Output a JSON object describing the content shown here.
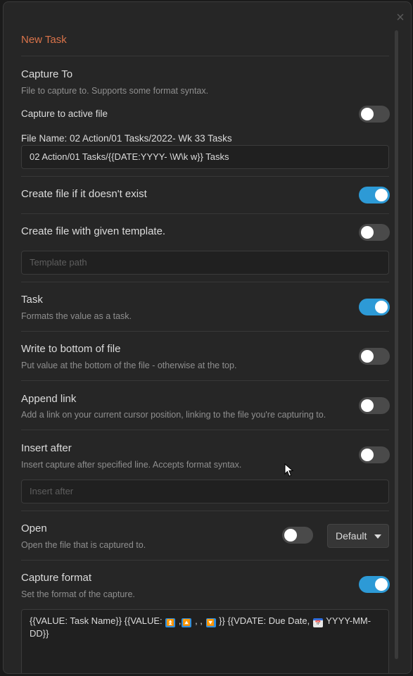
{
  "title": "New Task",
  "close_glyph": "×",
  "capture_to": {
    "name": "Capture To",
    "desc": "File to capture to. Supports some format syntax.",
    "active_file_label": "Capture to active file",
    "active_file_on": false,
    "file_name_label": "File Name: 02 Action/01 Tasks/2022- Wk 33 Tasks",
    "file_name_value": "02 Action/01 Tasks/{{DATE:YYYY-  \\W\\k w}} Tasks"
  },
  "create_file": {
    "name": "Create file if it doesn't exist",
    "on": true
  },
  "template": {
    "name": "Create file with given template.",
    "on": false,
    "placeholder": "Template path"
  },
  "task": {
    "name": "Task",
    "desc": "Formats the value as a task.",
    "on": true
  },
  "write_bottom": {
    "name": "Write to bottom of file",
    "desc": "Put value at the bottom of the file - otherwise at the top.",
    "on": false
  },
  "append_link": {
    "name": "Append link",
    "desc": "Add a link on your current cursor position, linking to the file you're capturing to.",
    "on": false
  },
  "insert_after": {
    "name": "Insert after",
    "desc": "Insert capture after specified line. Accepts format syntax.",
    "on": false,
    "placeholder": "Insert after"
  },
  "open": {
    "name": "Open",
    "desc": "Open the file that is captured to.",
    "on": false,
    "select_value": "Default"
  },
  "capture_format": {
    "name": "Capture format",
    "desc": "Set the format of the capture.",
    "on": true,
    "text_part1": "{{VALUE: Task Name}} {{VALUE: ",
    "text_part2": " ,",
    "text_part3": " , , ",
    "text_part4": " }} {{VDATE: Due Date, ",
    "text_part5": " YYYY-MM-DD}}",
    "emoji_high": "⏫",
    "emoji_up": "🔼",
    "emoji_down": "🔽",
    "emoji_calendar": "📅"
  }
}
